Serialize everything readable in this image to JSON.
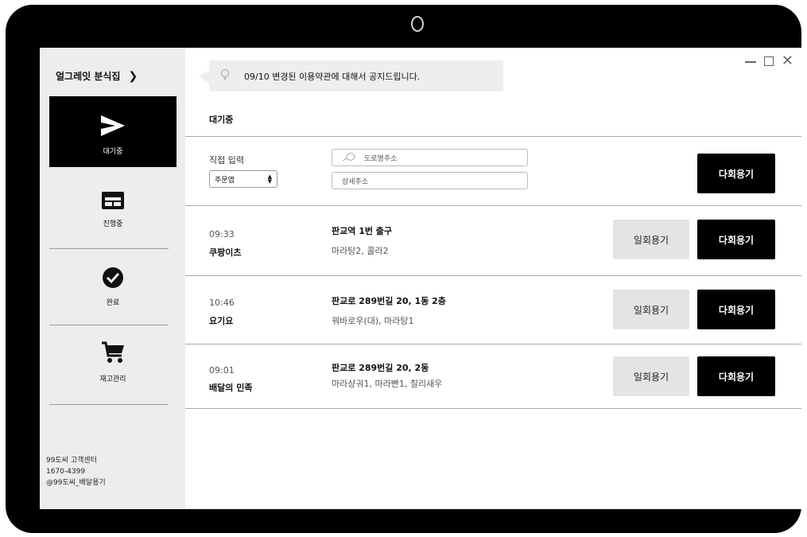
{
  "sidebar": {
    "store_name": "얼그레잇 분식집",
    "store_chevron": "❯",
    "nav": [
      {
        "label": "대기중",
        "icon": "send-icon"
      },
      {
        "label": "진행중",
        "icon": "list-layout-icon"
      },
      {
        "label": "완료",
        "icon": "check-circle-icon"
      },
      {
        "label": "재고관리",
        "icon": "cart-icon"
      }
    ],
    "support": {
      "line1": "99도씨 고객센터",
      "line2": "1670-4399",
      "line3": "@99도씨_배달용기"
    }
  },
  "notice": {
    "text": "09/10 변경된 이용약관에 대해서 공지드립니다.",
    "icon": "lightbulb-icon"
  },
  "tab_title": "대기중",
  "manual_entry": {
    "label": "직접 입력",
    "app_select": "주문앱",
    "road_placeholder": "도로명주소",
    "detail_placeholder": "상세주소",
    "multi_use_button": "다회용기"
  },
  "orders": [
    {
      "time": "09:33",
      "app": "쿠팡이츠",
      "address": "판교역 1번 출구",
      "menu": "마라탕2, 콜라2",
      "single_use": "일회용기",
      "multi_use": "다회용기"
    },
    {
      "time": "10:46",
      "app": "요기요",
      "address": "판교로 289번길 20, 1동 2층",
      "menu": "꿔바로우(대), 마라탕1",
      "single_use": "일회용기",
      "multi_use": "다회용기"
    },
    {
      "time": "09:01",
      "app": "배달의 민족",
      "address": "판교로 289번길 20, 2동",
      "menu": "마라샹궈1, 마라빤1, 칠리새우",
      "single_use": "일회용기",
      "multi_use": "다회용기"
    }
  ],
  "colors": {
    "frame": "#000000",
    "sidebar_bg": "#ededed",
    "active_nav_bg": "#000000",
    "primary_button": "#000000",
    "secondary_button": "#e4e4e4"
  }
}
